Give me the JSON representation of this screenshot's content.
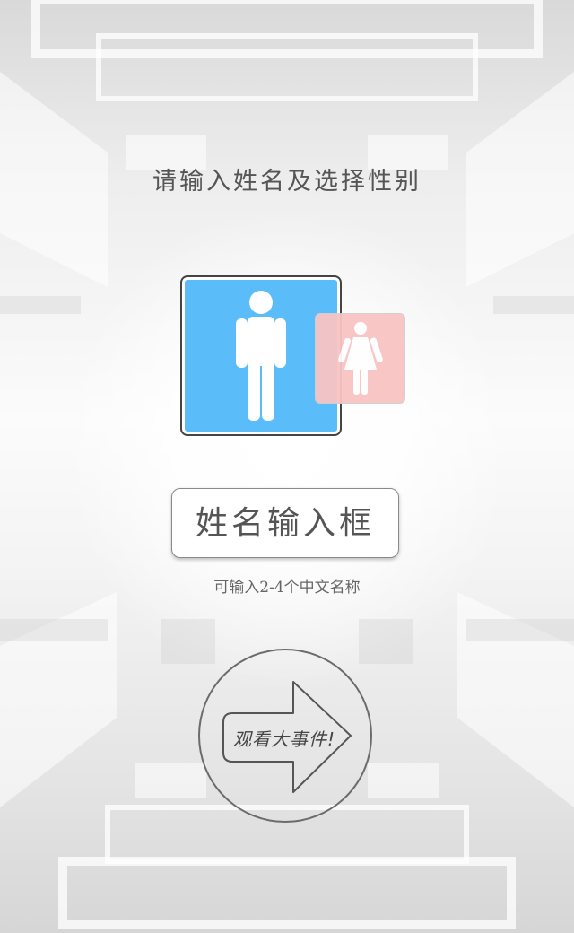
{
  "headline": "请输入姓名及选择性别",
  "gender_options": [
    {
      "id": "male",
      "icon": "male-figure-icon",
      "color": "#5bbcfa",
      "selected": true
    },
    {
      "id": "female",
      "icon": "female-figure-icon",
      "color": "#f9c4c4",
      "selected": false
    }
  ],
  "name_input": {
    "placeholder": "姓名输入框",
    "value": ""
  },
  "hint": "可输入2-4个中文名称",
  "watch_button": {
    "label": "观看大事件!",
    "icon": "arrow-right-icon"
  }
}
